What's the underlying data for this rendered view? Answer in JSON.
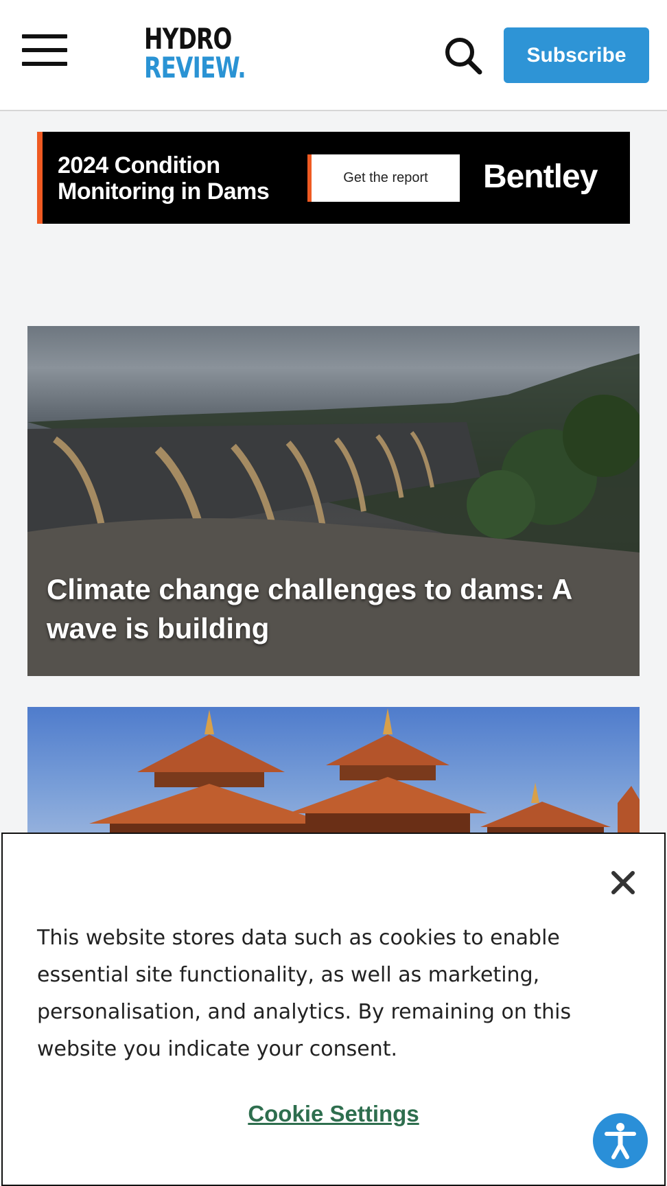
{
  "header": {
    "logo_line1": "HYDRO",
    "logo_line2": "REVIEW.",
    "subscribe_label": "Subscribe",
    "menu_icon": "hamburger-menu-icon",
    "search_icon": "search-icon"
  },
  "ad": {
    "title": "2024 Condition Monitoring in Dams",
    "cta_label": "Get the report",
    "brand": "Bentley",
    "accent_color": "#ef5a22"
  },
  "articles": [
    {
      "title": "Climate change challenges to dams: A wave is building"
    },
    {
      "title": ""
    }
  ],
  "cookie_banner": {
    "message": "This website stores data such as cookies to enable essential site functionality, as well as marketing, personalisation, and analytics. By remaining on this website you indicate your consent.",
    "settings_label": "Cookie Settings",
    "close_icon": "close-icon"
  },
  "accessibility": {
    "icon": "accessibility-icon"
  },
  "colors": {
    "brand_blue": "#2e94d6",
    "link_green": "#2e6e4e"
  }
}
